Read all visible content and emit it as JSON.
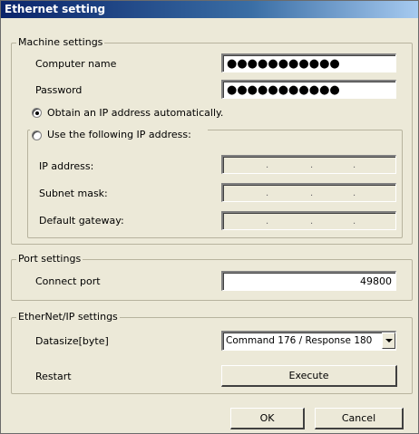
{
  "window": {
    "title": "Ethernet setting"
  },
  "machine_settings": {
    "legend": "Machine settings",
    "computer_name_label": "Computer name",
    "computer_name_value": "●●●●●●●●●●●",
    "password_label": "Password",
    "password_value": "●●●●●●●●●●●",
    "obtain_auto_label": "Obtain an IP address automatically.",
    "obtain_auto_checked": true,
    "use_following_label": "Use the following IP address:",
    "use_following_checked": false,
    "ip_address_label": "IP address:",
    "subnet_mask_label": "Subnet mask:",
    "default_gateway_label": "Default gateway:",
    "ip_separator": "."
  },
  "port_settings": {
    "legend": "Port settings",
    "connect_port_label": "Connect port",
    "connect_port_value": "49800"
  },
  "ethernetip_settings": {
    "legend": "EtherNet/IP settings",
    "datasize_label": "Datasize[byte]",
    "datasize_value": "Command  176 / Response  180",
    "restart_label": "Restart",
    "execute_label": "Execute"
  },
  "buttons": {
    "ok_label": "OK",
    "cancel_label": "Cancel"
  },
  "colors": {
    "dialog_bg": "#ece9d8",
    "titlebar_start": "#0a246a",
    "titlebar_end": "#a6caf0"
  }
}
